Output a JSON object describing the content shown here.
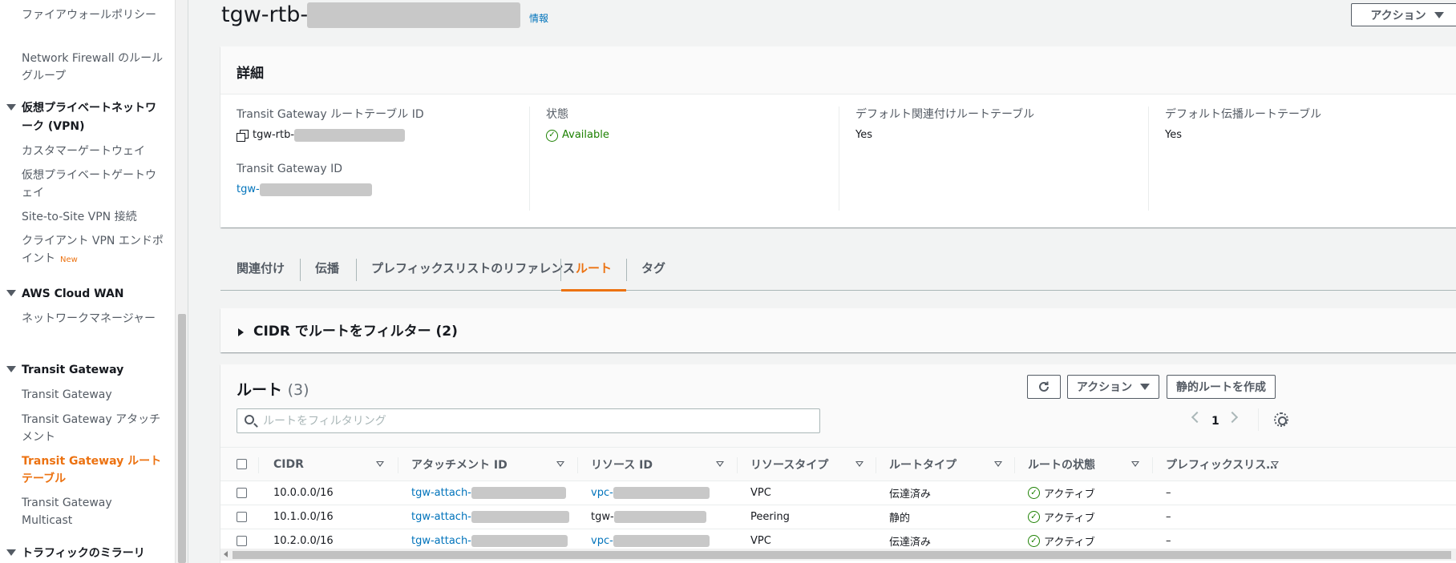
{
  "sidebar": {
    "items": [
      {
        "label": "ファイアウォールポリシー",
        "type": "item"
      },
      {
        "label": "Network Firewall のルールグループ",
        "type": "item"
      },
      {
        "label": "仮想プライベートネットワーク (VPN)",
        "type": "section"
      },
      {
        "label": "カスタマーゲートウェイ",
        "type": "item"
      },
      {
        "label": "仮想プライベートゲートウェイ",
        "type": "item"
      },
      {
        "label": "Site-to-Site VPN 接続",
        "type": "item"
      },
      {
        "label": "クライアント VPN エンドポイント",
        "type": "item",
        "badge": "New"
      },
      {
        "label": "AWS Cloud WAN",
        "type": "section"
      },
      {
        "label": "ネットワークマネージャー",
        "type": "item"
      },
      {
        "label": "Transit Gateway",
        "type": "section"
      },
      {
        "label": "Transit Gateway",
        "type": "item"
      },
      {
        "label": "Transit Gateway アタッチメント",
        "type": "item"
      },
      {
        "label": "Transit Gateway ルートテーブル",
        "type": "item",
        "active": true
      },
      {
        "label": "Transit Gateway Multicast",
        "type": "item"
      },
      {
        "label": "トラフィックのミラーリ",
        "type": "section"
      }
    ]
  },
  "header": {
    "title": "tgw-rtb-",
    "info_link": "情報",
    "actions_label": "アクション"
  },
  "details": {
    "title": "詳細",
    "route_table_id_label": "Transit Gateway ルートテーブル ID",
    "route_table_id_value": "tgw-rtb-",
    "tgw_id_label": "Transit Gateway ID",
    "tgw_id_value": "tgw-",
    "state_label": "状態",
    "state_value": "Available",
    "default_assoc_label": "デフォルト関連付けルートテーブル",
    "default_assoc_value": "Yes",
    "default_prop_label": "デフォルト伝播ルートテーブル",
    "default_prop_value": "Yes"
  },
  "tabs": [
    {
      "label": "関連付け",
      "active": false
    },
    {
      "label": "伝播",
      "active": false
    },
    {
      "label": "プレフィックスリストのリファレンス",
      "active": false
    },
    {
      "label": "ルート",
      "active": true
    },
    {
      "label": "タグ",
      "active": false
    }
  ],
  "filter": {
    "title": "CIDR でルートをフィルター (2)"
  },
  "routes": {
    "title": "ルート",
    "count": "(3)",
    "actions_label": "アクション",
    "create_label": "静的ルートを作成",
    "search_placeholder": "ルートをフィルタリング",
    "page": "1",
    "columns": [
      "CIDR",
      "アタッチメント ID",
      "リソース ID",
      "リソースタイプ",
      "ルートタイプ",
      "ルートの状態",
      "プレフィックスリス…"
    ],
    "rows": [
      {
        "cidr": "10.0.0.0/16",
        "attachment": "tgw-attach-",
        "resource": "vpc-",
        "resource_type": "VPC",
        "route_type": "伝達済み",
        "state": "アクティブ",
        "prefix": "–"
      },
      {
        "cidr": "10.1.0.0/16",
        "attachment": "tgw-attach-",
        "resource": "tgw-",
        "resource_type": "Peering",
        "route_type": "静的",
        "state": "アクティブ",
        "prefix": "–"
      },
      {
        "cidr": "10.2.0.0/16",
        "attachment": "tgw-attach-",
        "resource": "vpc-",
        "resource_type": "VPC",
        "route_type": "伝達済み",
        "state": "アクティブ",
        "prefix": "–"
      }
    ]
  },
  "colors": {
    "accent": "#ec7211",
    "link": "#0073bb",
    "success": "#1d8102"
  }
}
